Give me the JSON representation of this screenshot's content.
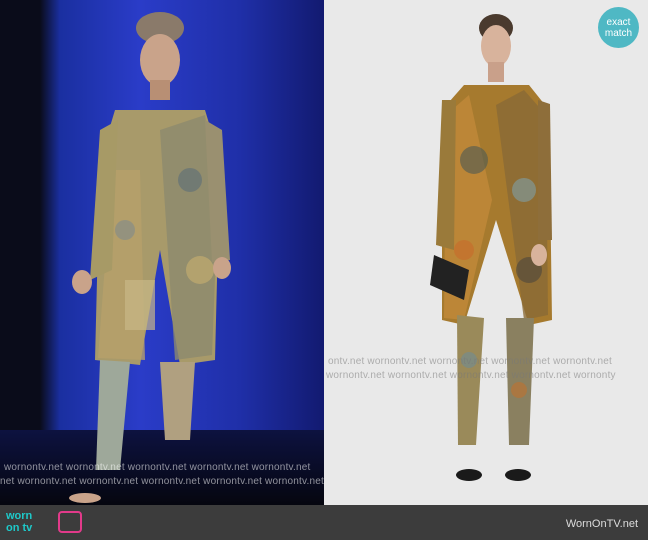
{
  "badge": {
    "line1": "exact",
    "line2": "match"
  },
  "watermarks": {
    "left_rows": [
      "wornontv.net  wornontv.net  wornontv.net  wornontv.net  wornontv.net",
      "net  wornontv.net  wornontv.net  wornontv.net  wornontv.net  wornontv.net"
    ],
    "right_rows": [
      "ontv.net  wornontv.net  wornontv.net  wornontv.net  wornontv.net",
      "wornontv.net  wornontv.net  wornontv.net  wornontv.net  wornonty"
    ]
  },
  "footer": {
    "logo_line1": "worn",
    "logo_line2": "on tv",
    "site": "WornOnTV.net"
  },
  "colors": {
    "stage_blue": "#2a3cc8",
    "studio_gray": "#e9e9e9",
    "badge": "#4fb8c4",
    "logo_teal": "#1ec9c9",
    "logo_pink": "#e23a8a"
  }
}
